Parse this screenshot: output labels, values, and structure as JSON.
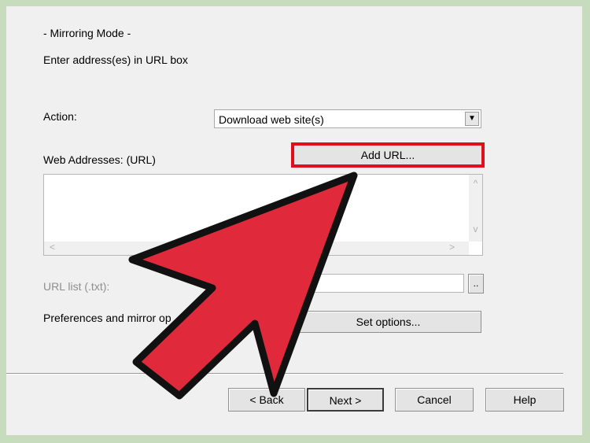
{
  "header": {
    "mode_title": "- Mirroring Mode -",
    "instruction": "Enter address(es) in URL box"
  },
  "action": {
    "label": "Action:",
    "selected": "Download web site(s)"
  },
  "web_addresses": {
    "label": "Web Addresses: (URL)",
    "add_url_label": "Add URL...",
    "value": ""
  },
  "url_list": {
    "label": "URL list (.txt):",
    "browse_label": "..",
    "value": ""
  },
  "preferences": {
    "label": "Preferences and mirror op",
    "set_options_label": "Set options..."
  },
  "footer": {
    "back_label": "< Back",
    "next_label": "Next >",
    "cancel_label": "Cancel",
    "help_label": "Help"
  },
  "overlay": {
    "arrow_color": "#e02a3c",
    "highlight_color": "#e10e1c"
  }
}
